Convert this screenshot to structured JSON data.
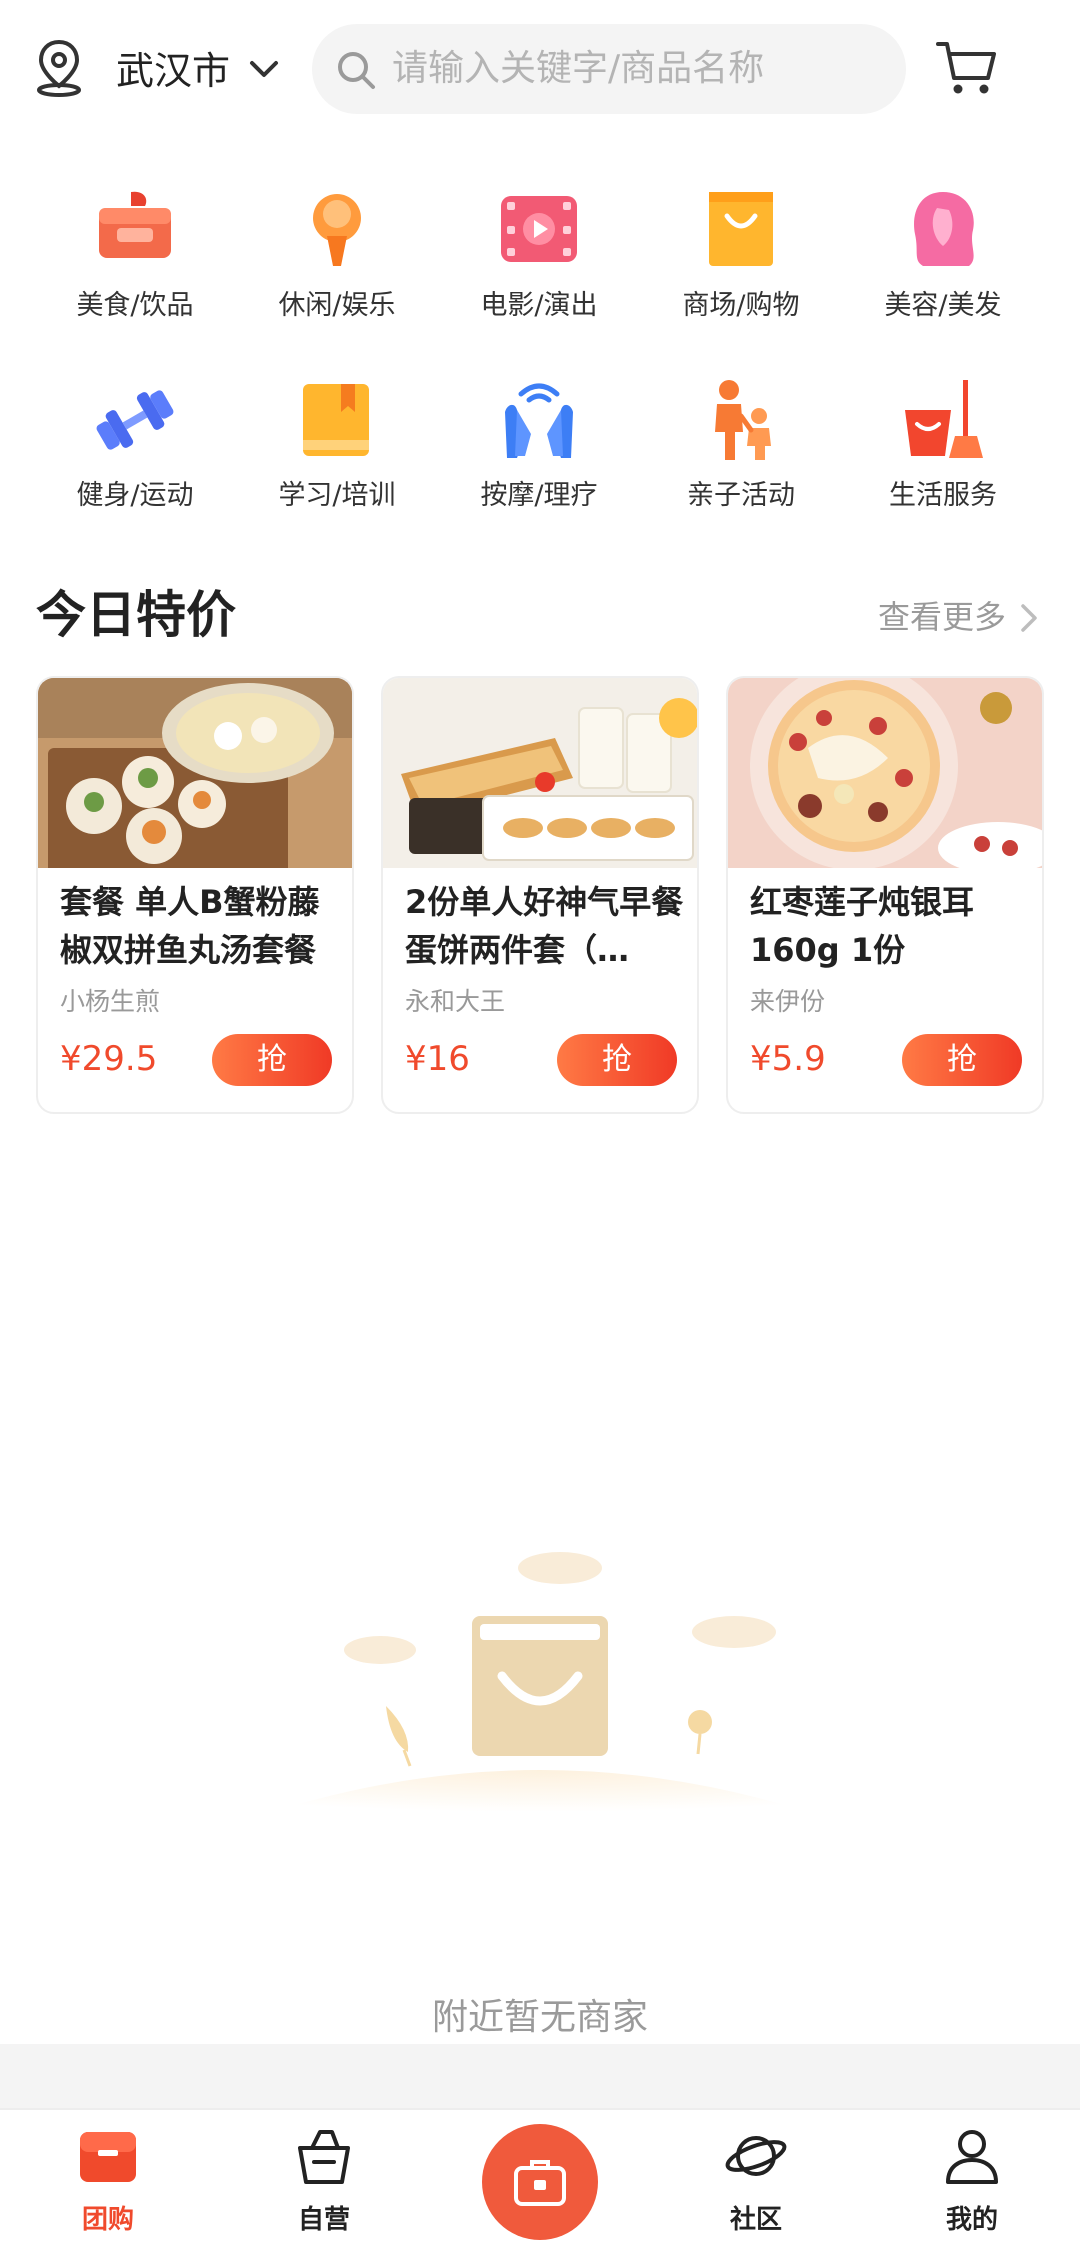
{
  "header": {
    "city": "武汉市",
    "search_placeholder": "请输入关键字/商品名称",
    "location_icon": "location-pin-icon",
    "cart_icon": "shopping-cart-icon"
  },
  "categories": [
    {
      "label": "美食/饮品",
      "icon": "food-drink-icon"
    },
    {
      "label": "休闲/娱乐",
      "icon": "leisure-icon"
    },
    {
      "label": "电影/演出",
      "icon": "movie-icon"
    },
    {
      "label": "商场/购物",
      "icon": "shopping-bag-icon"
    },
    {
      "label": "美容/美发",
      "icon": "beauty-hair-icon"
    },
    {
      "label": "健身/运动",
      "icon": "dumbbell-icon"
    },
    {
      "label": "学习/培训",
      "icon": "book-icon"
    },
    {
      "label": "按摩/理疗",
      "icon": "massage-hands-icon"
    },
    {
      "label": "亲子活动",
      "icon": "parent-child-icon"
    },
    {
      "label": "生活服务",
      "icon": "cleaning-bucket-icon"
    }
  ],
  "deals_section": {
    "title": "今日特价",
    "more_label": "查看更多",
    "items": [
      {
        "title": "套餐 单人B蟹粉藤椒双拼鱼丸汤套餐",
        "shop": "小杨生煎",
        "price": "¥29.5",
        "button": "抢"
      },
      {
        "title": "2份单人好神气早餐蛋饼两件套（…",
        "shop": "永和大王",
        "price": "¥16",
        "button": "抢"
      },
      {
        "title": "红枣莲子炖银耳 160g 1份",
        "shop": "来伊份",
        "price": "¥5.9",
        "button": "抢"
      }
    ]
  },
  "empty_state": {
    "text": "附近暂无商家"
  },
  "bottom_nav": [
    {
      "label": "团购",
      "icon": "group-buy-icon",
      "active": true
    },
    {
      "label": "自营",
      "icon": "basket-icon",
      "active": false
    },
    {
      "label": "",
      "icon": "center-toolbox-icon",
      "active": false
    },
    {
      "label": "社区",
      "icon": "planet-icon",
      "active": false
    },
    {
      "label": "我的",
      "icon": "user-icon",
      "active": false
    }
  ],
  "colors": {
    "accent": "#f04a2c",
    "button_gradient_start": "#ff7a45",
    "button_gradient_end": "#f03a26",
    "muted_text": "#9a9a9a"
  }
}
